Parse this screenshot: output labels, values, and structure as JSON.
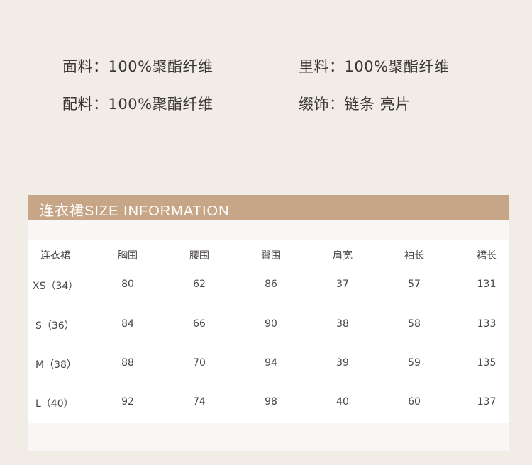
{
  "materials": {
    "fabric": {
      "label": "面料：",
      "value": "100%聚酯纤维"
    },
    "lining": {
      "label": "里料：",
      "value": "100%聚酯纤维"
    },
    "accessories": {
      "label": "配料：",
      "value": "100%聚酯纤维"
    },
    "decoration": {
      "label": "缀饰：",
      "value": "链条 亮片"
    }
  },
  "size_section": {
    "title": "连衣裙SIZE INFORMATION"
  },
  "size_table": {
    "headers": [
      "连衣裙",
      "胸围",
      "腰围",
      "臀围",
      "肩宽",
      "袖长",
      "裙长"
    ],
    "rows": [
      [
        "XS（34）",
        "80",
        "62",
        "86",
        "37",
        "57",
        "131"
      ],
      [
        "S（36）",
        "84",
        "66",
        "90",
        "38",
        "58",
        "133"
      ],
      [
        "M（38）",
        "88",
        "70",
        "94",
        "39",
        "59",
        "135"
      ],
      [
        "L（40）",
        "92",
        "74",
        "98",
        "40",
        "60",
        "137"
      ]
    ]
  }
}
